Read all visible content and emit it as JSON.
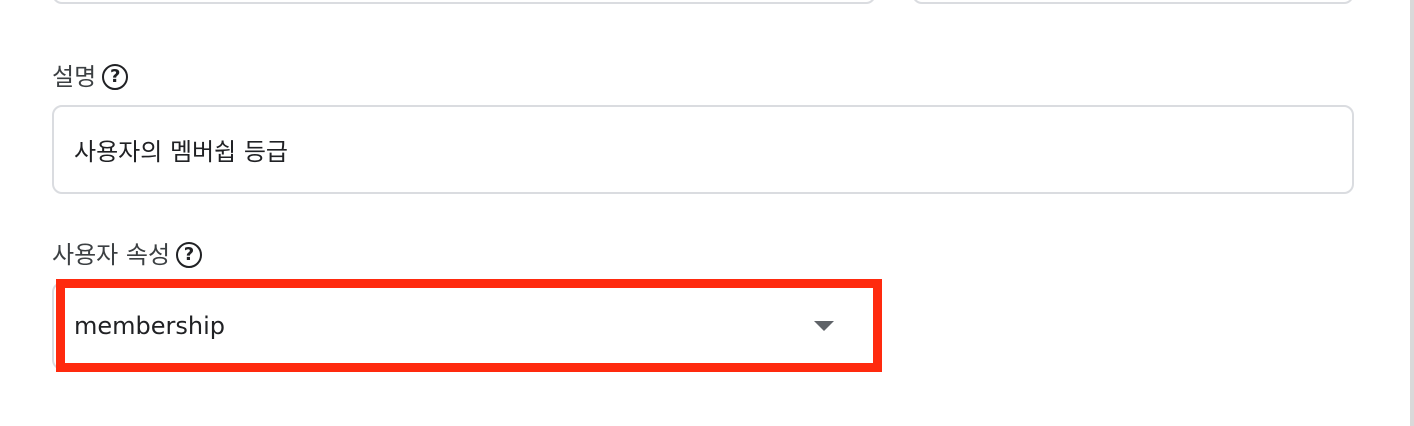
{
  "form": {
    "description": {
      "label": "설명",
      "value": "사용자의 멤버쉽 등급",
      "help_icon": "question-circle-icon"
    },
    "user_attribute": {
      "label": "사용자 속성",
      "selected_value": "membership",
      "help_icon": "question-circle-icon",
      "dropdown_icon": "arrow-drop-down-icon"
    }
  },
  "highlight": {
    "color": "#ff2a0e"
  }
}
